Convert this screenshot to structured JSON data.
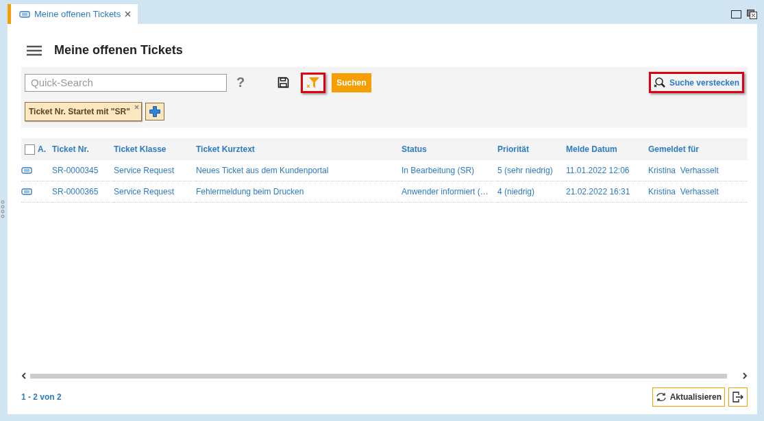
{
  "tab": {
    "label": "Meine offenen Tickets",
    "selected": true
  },
  "page_title": "Meine offenen Tickets",
  "search": {
    "placeholder": "Quick-Search",
    "help": "?",
    "filter_highlighted": true,
    "submit": "Suchen",
    "hide_search": "Suche verstecken",
    "hide_highlighted": true
  },
  "filters": [
    {
      "label": "Ticket Nr. Startet mit \"SR\""
    }
  ],
  "table": {
    "columns": [
      "A.",
      "Ticket Nr.",
      "Ticket Klasse",
      "Ticket Kurztext",
      "Status",
      "Priorität",
      "Melde Datum",
      "Gemeldet für"
    ],
    "all_checked": false,
    "rows": [
      {
        "cells": [
          "",
          "SR-0000345",
          "Service Request",
          "Neues Ticket aus dem Kundenportal",
          "In Bearbeitung (SR)",
          "5 (sehr niedrig)",
          "11.01.2022 12:06",
          "Kristina  Verhasselt"
        ]
      },
      {
        "cells": [
          "",
          "SR-0000365",
          "Service Request",
          "Fehlermeldung beim Drucken",
          "Anwender informiert (…",
          "4 (niedrig)",
          "21.02.2022 16:31",
          "Kristina  Verhasselt"
        ]
      }
    ]
  },
  "footer": {
    "count": "1 - 2 von 2",
    "refresh": "Aktualisieren"
  }
}
